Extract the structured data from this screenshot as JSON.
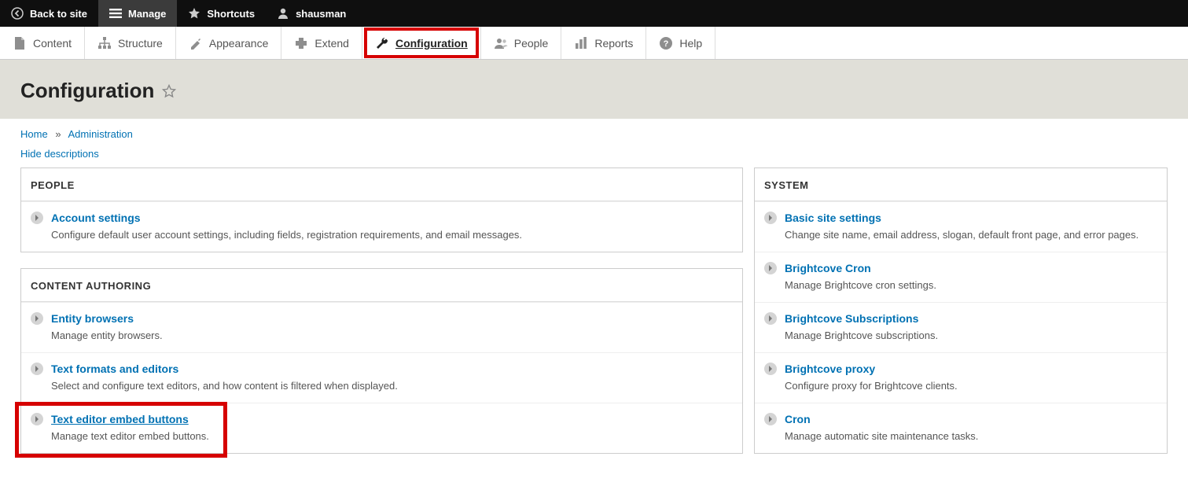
{
  "toolbar": {
    "back": "Back to site",
    "manage": "Manage",
    "shortcuts": "Shortcuts",
    "user": "shausman"
  },
  "admin_menu": {
    "content": "Content",
    "structure": "Structure",
    "appearance": "Appearance",
    "extend": "Extend",
    "configuration": "Configuration",
    "people": "People",
    "reports": "Reports",
    "help": "Help"
  },
  "page": {
    "title": "Configuration"
  },
  "breadcrumb": {
    "home": "Home",
    "admin": "Administration"
  },
  "hide_descriptions": "Hide descriptions",
  "left": {
    "people": {
      "heading": "PEOPLE",
      "account": {
        "title": "Account settings",
        "desc": "Configure default user account settings, including fields, registration requirements, and email messages."
      }
    },
    "content_authoring": {
      "heading": "CONTENT AUTHORING",
      "entity_browsers": {
        "title": "Entity browsers",
        "desc": "Manage entity browsers."
      },
      "text_formats": {
        "title": "Text formats and editors",
        "desc": "Select and configure text editors, and how content is filtered when displayed."
      },
      "embed_buttons": {
        "title": "Text editor embed buttons",
        "desc": "Manage text editor embed buttons."
      }
    }
  },
  "right": {
    "system": {
      "heading": "SYSTEM",
      "basic": {
        "title": "Basic site settings",
        "desc": "Change site name, email address, slogan, default front page, and error pages."
      },
      "bc_cron": {
        "title": "Brightcove Cron",
        "desc": "Manage Brightcove cron settings."
      },
      "bc_subs": {
        "title": "Brightcove Subscriptions",
        "desc": "Manage Brightcove subscriptions."
      },
      "bc_proxy": {
        "title": "Brightcove proxy",
        "desc": "Configure proxy for Brightcove clients."
      },
      "cron": {
        "title": "Cron",
        "desc": "Manage automatic site maintenance tasks."
      }
    }
  }
}
